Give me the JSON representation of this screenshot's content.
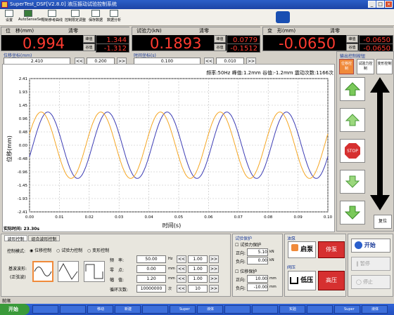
{
  "window": {
    "title": "SuperTest_DSF[V2.8.0] 液压振动试验控制系统"
  },
  "toolbar": {
    "items": [
      "设置",
      "AutoSenseSet",
      "限制参考曲线",
      "控制限定调整",
      "保存数据",
      "数据分析"
    ]
  },
  "meters": [
    {
      "title": "位　移(mm)",
      "clear": "清零",
      "value": "0.994",
      "max_label": "峰值",
      "max": "1.344",
      "min_label": "谷值",
      "min": "-1.312"
    },
    {
      "title": "试验力(kN)",
      "clear": "清零",
      "value": "0.1893",
      "max_label": "峰值",
      "max": "0.0779",
      "min_label": "谷值",
      "min": "-0.1512"
    },
    {
      "title": "变　形(mm)",
      "clear": "清零",
      "value": "-0.0650",
      "max_label": "峰值",
      "max": "-0.0650",
      "min_label": "谷值",
      "min": "-0.0650"
    }
  ],
  "axisControls": {
    "left": {
      "label": "位移坐标(mm)",
      "v1": "2.410",
      "btn1": "<<",
      "v2": "0.200",
      "btn2": ">>"
    },
    "mid": {
      "label": "时间坐标(s)",
      "v1": "0.100",
      "btn1": "<<",
      "v2": "0.010",
      "btn2": ">>"
    }
  },
  "chart_data": {
    "type": "line",
    "info": "频率:50Hz  峰值:1.2mm  谷值:-1.2mm  震动次数:1166次",
    "xlabel": "时间(s)",
    "ylabel": "位移(mm)",
    "xlim": [
      0,
      0.1
    ],
    "ylim": [
      -2.41,
      2.41
    ],
    "xticks": [
      "0.00",
      "0.01",
      "0.02",
      "0.03",
      "0.04",
      "0.05",
      "0.06",
      "0.07",
      "0.08",
      "0.09",
      "0.10"
    ],
    "yticks": [
      "2.41",
      "1.93",
      "1.45",
      "0.96",
      "0.48",
      "0.00",
      "-0.48",
      "-0.96",
      "-1.45",
      "-1.93",
      "-2.41"
    ],
    "series": [
      {
        "color": "#3c3cb4",
        "amplitude": 1.2,
        "freq": 50,
        "phase": -0.35
      },
      {
        "color": "#f5a623",
        "amplitude": 1.2,
        "freq": 50,
        "phase": 0.35
      }
    ],
    "grid": true
  },
  "status": {
    "time_label": "实际时间:",
    "time_value": "23.30s"
  },
  "sidePanel": {
    "title": "输出控制按钮",
    "tabs": [
      "位移控制",
      "试验力控制",
      "变形控制"
    ],
    "buttons": [
      "up-fast",
      "up",
      "stop",
      "down",
      "down-fast"
    ],
    "reset": "复位"
  },
  "bottom": {
    "tabs": [
      "波形控制",
      "组合波形控制"
    ],
    "modeLabel": "控制模式:",
    "modes": [
      "位移控制",
      "试验力控制",
      "变形控制"
    ],
    "waveLabel": "基波波形:",
    "waveSub": "(正弦波)",
    "params": [
      {
        "label": "频　率:",
        "value": "50.00",
        "unit": "Hz",
        "step": "1.00"
      },
      {
        "label": "零　点:",
        "value": "0.00",
        "unit": "mm",
        "step": "1.00"
      },
      {
        "label": "幅　值:",
        "value": "1.20",
        "unit": "mm",
        "step": "1.00"
      },
      {
        "label": "循环次数:",
        "value": "10000000",
        "unit": "次",
        "step": "10"
      }
    ],
    "protectTitle": "试验保护",
    "forceProtect": {
      "label": "试验力保护",
      "up": "5.10",
      "down": "0.00",
      "unit": "kN",
      "upL": "正向:",
      "downL": "负向:"
    },
    "dispProtect": {
      "label": "位移保护",
      "up": "10.00",
      "down": "-10.00",
      "unit": "mm",
      "upL": "正向:",
      "downL": "负向:"
    },
    "pumpTitle": "油泵",
    "pumpStart": "启泵",
    "pumpStop": "停泵",
    "valveTitle": "阀压",
    "low": "低压",
    "high": "高压",
    "start": "开始",
    "pause": "暂停",
    "stop": "停止"
  },
  "statusbar": {
    "text": "就绪"
  },
  "taskbar": {
    "start": "开始",
    "tasks": [
      "",
      "",
      "移动",
      "新建",
      "",
      "Super",
      "液体",
      "",
      "",
      "实验",
      "",
      "Super",
      "液体"
    ],
    "clock": ""
  }
}
